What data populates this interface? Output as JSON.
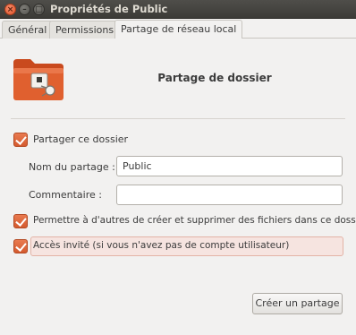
{
  "window": {
    "title": "Propriétés de Public",
    "close_glyph": "×",
    "minimize_glyph": "–",
    "maximize_glyph": "□"
  },
  "tabs": [
    {
      "label": "Général",
      "active": false
    },
    {
      "label": "Permissions",
      "active": false
    },
    {
      "label": "Partage de réseau local",
      "active": true
    }
  ],
  "header": {
    "icon": "folder-share-icon",
    "title": "Partage de dossier"
  },
  "form": {
    "share_checkbox": {
      "label": "Partager ce dossier",
      "checked": true
    },
    "share_name": {
      "label": "Nom du partage :",
      "value": "Public"
    },
    "comment": {
      "label": "Commentaire :",
      "value": ""
    },
    "allow_others": {
      "label": "Permettre à d'autres de créer et supprimer des fichiers dans ce dossier",
      "checked": true
    },
    "guest_access": {
      "label": "Accès invité (si vous n'avez pas de compte utilisateur)",
      "checked": true
    }
  },
  "actions": {
    "create_share": "Créer un partage"
  },
  "colors": {
    "accent": "#dd5f32",
    "titlebar": "#3c3b37",
    "background": "#f2f1f0",
    "highlight": "#f6e4e0"
  }
}
